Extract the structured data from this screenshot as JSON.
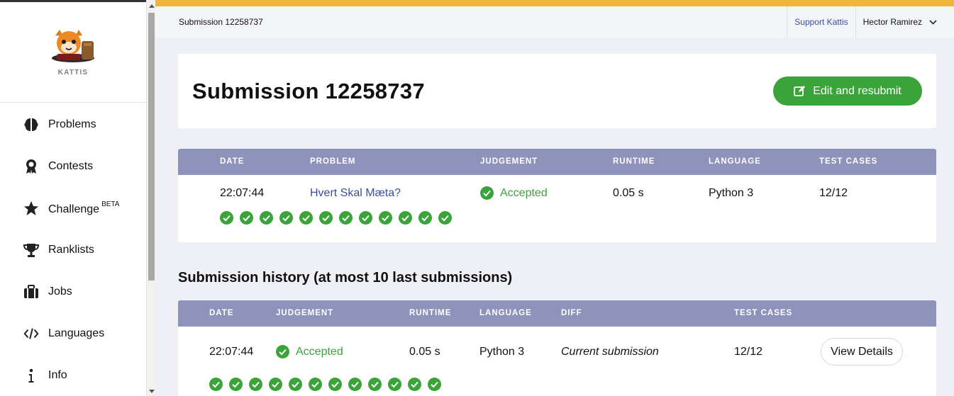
{
  "brand": {
    "name": "KATTIS"
  },
  "sidebar": {
    "items": [
      {
        "label": "Problems",
        "icon": "brain-icon"
      },
      {
        "label": "Contests",
        "icon": "award-icon"
      },
      {
        "label": "Challenge",
        "badge": "BETA",
        "icon": "star-icon"
      },
      {
        "label": "Ranklists",
        "icon": "trophy-icon"
      },
      {
        "label": "Jobs",
        "icon": "briefcase-icon"
      },
      {
        "label": "Languages",
        "icon": "code-icon"
      },
      {
        "label": "Info",
        "icon": "info-icon"
      }
    ]
  },
  "topbar": {
    "breadcrumb": "Submission 12258737",
    "support": "Support Kattis",
    "user": "Hector Ramirez"
  },
  "header": {
    "title": "Submission 12258737",
    "edit_button": "Edit and resubmit"
  },
  "submission": {
    "columns": {
      "date": "DATE",
      "problem": "PROBLEM",
      "judgement": "JUDGEMENT",
      "runtime": "RUNTIME",
      "language": "LANGUAGE",
      "test_cases": "TEST CASES"
    },
    "row": {
      "date": "22:07:44",
      "problem": "Hvert Skal Mæta?",
      "judgement": "Accepted",
      "runtime": "0.05 s",
      "language": "Python 3",
      "test_cases": "12/12",
      "passed_cases": 12
    }
  },
  "history": {
    "title": "Submission history (at most 10 last submissions)",
    "columns": {
      "date": "DATE",
      "judgement": "JUDGEMENT",
      "runtime": "RUNTIME",
      "language": "LANGUAGE",
      "diff": "DIFF",
      "test_cases": "TEST CASES"
    },
    "rows": [
      {
        "date": "22:07:44",
        "judgement": "Accepted",
        "runtime": "0.05 s",
        "language": "Python 3",
        "diff": "Current submission",
        "test_cases": "12/12",
        "passed_cases": 12,
        "action": "View Details"
      }
    ]
  },
  "colors": {
    "accent": "#f0b63b",
    "success": "#3aa339",
    "table_header": "#8e93bb",
    "link": "#3a4f9c"
  }
}
